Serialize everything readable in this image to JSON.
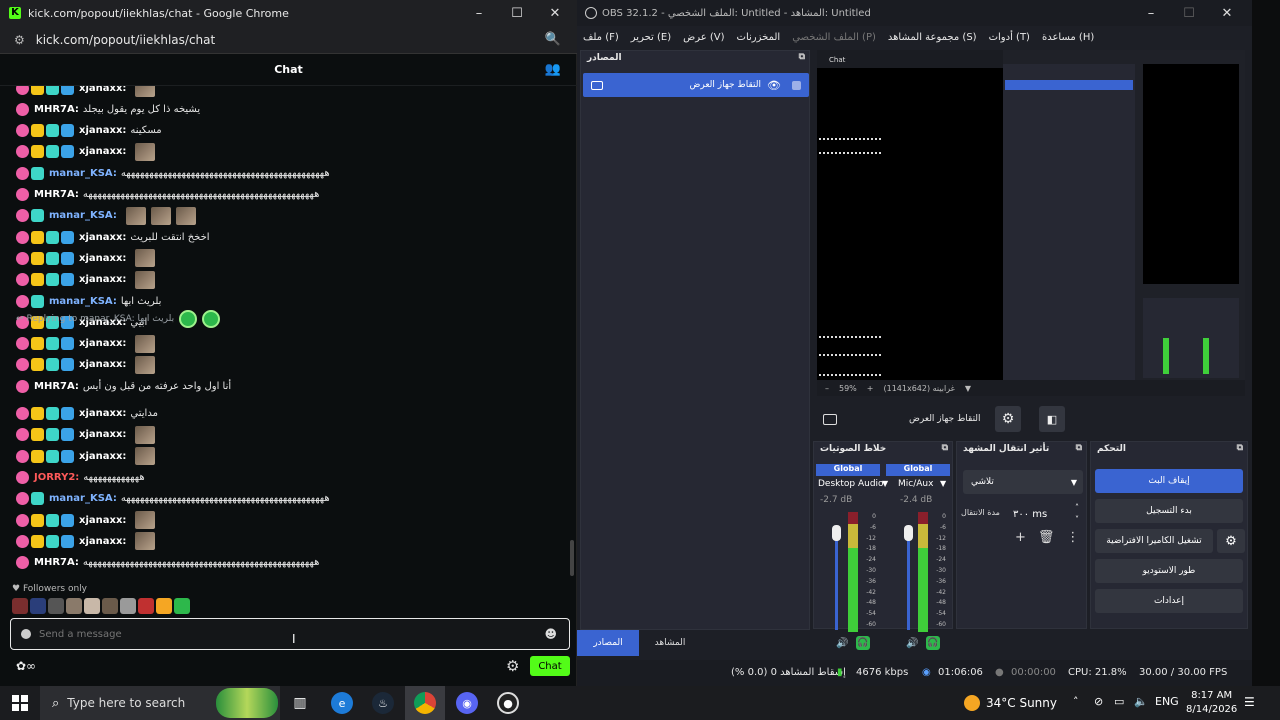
{
  "chrome": {
    "title": "kick.com/popout/iiekhlas/chat - Google Chrome",
    "url": "kick.com/popout/iiekhlas/chat",
    "header": "Chat",
    "reply_to": "Replying to manar_KSA: بلريث ابها",
    "followers_only": "Followers only",
    "input_placeholder": "Send a message",
    "chat_button": "Chat",
    "messages": [
      {
        "user": "xjanaxx:",
        "text": "",
        "color": "white"
      },
      {
        "user": "MHR7A:",
        "text": "يشيخه ذا كل يوم يقول بيجلد",
        "color": "white"
      },
      {
        "user": "xjanaxx:",
        "text": "مسكينه",
        "color": "white"
      },
      {
        "user": "xjanaxx:",
        "text": "",
        "color": "white"
      },
      {
        "user": "manar_KSA:",
        "text": "ههههههههههههههههههههههههههههههههههههههههههههه",
        "color": "blue"
      },
      {
        "user": "MHR7A:",
        "text": "ههههههههههههههههههههههههههههههههههههههههههههههههههه",
        "color": "white"
      },
      {
        "user": "manar_KSA:",
        "text": "",
        "color": "blue"
      },
      {
        "user": "xjanaxx:",
        "text": "اخخخ انتقت للبريث",
        "color": "white"
      },
      {
        "user": "xjanaxx:",
        "text": "",
        "color": "white"
      },
      {
        "user": "xjanaxx:",
        "text": "",
        "color": "white"
      },
      {
        "user": "manar_KSA:",
        "text": "بلريث ابها",
        "color": "blue"
      },
      {
        "user": "xjanaxx:",
        "text": "ابيي",
        "color": "white"
      },
      {
        "user": "xjanaxx:",
        "text": "",
        "color": "white"
      },
      {
        "user": "xjanaxx:",
        "text": "",
        "color": "white"
      },
      {
        "user": "MHR7A:",
        "text": "أنا اول واحد عرفته من قبل ون أيس",
        "color": "white"
      },
      {
        "user": "xjanaxx:",
        "text": "مدايتي",
        "color": "white"
      },
      {
        "user": "xjanaxx:",
        "text": "",
        "color": "white"
      },
      {
        "user": "xjanaxx:",
        "text": "",
        "color": "white"
      },
      {
        "user": "JORRY2:",
        "text": "ههههههههههههه",
        "color": "red"
      },
      {
        "user": "manar_KSA:",
        "text": "ههههههههههههههههههههههههههههههههههههههههههههه",
        "color": "blue"
      },
      {
        "user": "xjanaxx:",
        "text": "",
        "color": "white"
      },
      {
        "user": "xjanaxx:",
        "text": "",
        "color": "white"
      },
      {
        "user": "MHR7A:",
        "text": "ههههههههههههههههههههههههههههههههههههههههههههههههههه",
        "color": "white"
      }
    ]
  },
  "obs": {
    "title": "OBS 32.1.2 - الملف الشخصي: Untitled - المشاهد: Untitled",
    "menu": [
      "ملف (F)",
      "تحرير (E)",
      "عرض (V)",
      "المخزرنات",
      "الملف الشخصي (P)",
      "مجموعة المشاهد (S)",
      "أدوات (T)",
      "مساعدة (H)"
    ],
    "sources_title": "المصادر",
    "source_item": "التقاط جهاز العرض",
    "tab_sources": "المصادر",
    "tab_scenes": "المشاهد",
    "preview_zoom": "59%",
    "preview_res": "(1141x642) غرابينه",
    "scene_source_label": "التقاط جهاز العرض",
    "mixer_title": "خلاط الصوتيات",
    "transition_title": "تأثير انتقال المشهد",
    "controls_title": "التحكم",
    "mixer_channels": [
      {
        "head": "Global",
        "name": "Desktop Audio",
        "db": "-2.7 dB"
      },
      {
        "head": "Global",
        "name": "Mic/Aux",
        "db": "-2.4 dB"
      }
    ],
    "meter_scale": [
      "0",
      "-6",
      "-12",
      "-18",
      "-24",
      "-30",
      "-36",
      "-42",
      "-48",
      "-54",
      "-60"
    ],
    "transition_type": "تلاشي",
    "duration_label": "مدة الانتقال",
    "duration_value": "٣٠٠ ms",
    "controls": [
      "إيقاف البث",
      "بدء التسجيل",
      "تشغيل الكاميرا الافتراضية",
      "طور الاستوديو",
      "إعدادات"
    ],
    "status": {
      "dropped": "إسقاط المشاهد 0 (0.0 %)",
      "bitrate": "4676 kbps",
      "stream_time": "01:06:06",
      "rec_time": "00:00:00",
      "cpu": "CPU: 21.8%",
      "fps": "30.00 / 30.00 FPS"
    }
  },
  "taskbar": {
    "search_placeholder": "Type here to search",
    "weather": "34°C  Sunny",
    "lang": "ENG",
    "time": "8:17 AM",
    "date": "8/14/2026"
  }
}
